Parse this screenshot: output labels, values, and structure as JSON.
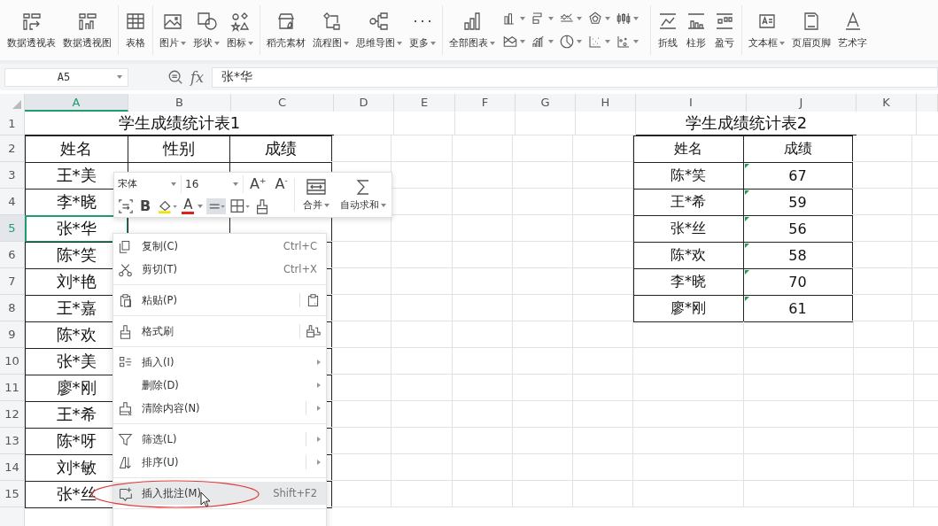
{
  "toolbar": [
    {
      "kind": "pivot",
      "label": "数据透视表",
      "dropdown": false
    },
    {
      "kind": "pivotchart",
      "label": "数据透视图",
      "dropdown": false
    },
    {
      "kind": "separator"
    },
    {
      "kind": "table",
      "label": "表格",
      "dropdown": false
    },
    {
      "kind": "separator"
    },
    {
      "kind": "image",
      "label": "图片",
      "dropdown": true
    },
    {
      "kind": "shape",
      "label": "形状",
      "dropdown": true
    },
    {
      "kind": "icons",
      "label": "图标",
      "dropdown": true
    },
    {
      "kind": "separator"
    },
    {
      "kind": "store",
      "label": "稻壳素材",
      "dropdown": false
    },
    {
      "kind": "flow",
      "label": "流程图",
      "dropdown": true
    },
    {
      "kind": "mindmap",
      "label": "思维导图",
      "dropdown": true
    },
    {
      "kind": "more",
      "label": "更多",
      "dropdown": true
    },
    {
      "kind": "separator"
    },
    {
      "kind": "chart",
      "label": "全部图表",
      "dropdown": true
    },
    {
      "kind": "chartgrid"
    },
    {
      "kind": "separator"
    },
    {
      "kind": "line",
      "label": "折线",
      "dropdown": false
    },
    {
      "kind": "column",
      "label": "柱形",
      "dropdown": false
    },
    {
      "kind": "winloss",
      "label": "盈亏",
      "dropdown": false
    },
    {
      "kind": "separator"
    },
    {
      "kind": "textbox",
      "label": "文本框",
      "dropdown": true
    },
    {
      "kind": "header",
      "label": "页眉页脚",
      "dropdown": false
    },
    {
      "kind": "wordart",
      "label": "艺术字",
      "dropdown": false
    }
  ],
  "formula_bar": {
    "name_box": "A5",
    "fx_label": "fx",
    "value": "张*华"
  },
  "sheet": {
    "columns": [
      {
        "label": "A",
        "selected": true
      },
      {
        "label": "B",
        "selected": false
      },
      {
        "label": "C",
        "selected": false
      },
      {
        "label": "D",
        "selected": false
      },
      {
        "label": "E",
        "selected": false
      },
      {
        "label": "F",
        "selected": false
      },
      {
        "label": "G",
        "selected": false
      },
      {
        "label": "H",
        "selected": false
      },
      {
        "label": "I",
        "selected": false
      },
      {
        "label": "J",
        "selected": false
      },
      {
        "label": "K",
        "selected": false
      }
    ],
    "rows": [
      {
        "label": "1",
        "selected": false
      },
      {
        "label": "2",
        "selected": false
      },
      {
        "label": "3",
        "selected": false
      },
      {
        "label": "4",
        "selected": false
      },
      {
        "label": "5",
        "selected": true
      },
      {
        "label": "6",
        "selected": false
      },
      {
        "label": "7",
        "selected": false
      },
      {
        "label": "8",
        "selected": false
      },
      {
        "label": "9",
        "selected": false
      },
      {
        "label": "10",
        "selected": false
      },
      {
        "label": "11",
        "selected": false
      },
      {
        "label": "12",
        "selected": false
      },
      {
        "label": "13",
        "selected": false
      },
      {
        "label": "14",
        "selected": false
      },
      {
        "label": "15",
        "selected": false
      }
    ]
  },
  "table1": {
    "title": "学生成绩统计表1",
    "columns": [
      "姓名",
      "性别",
      "成绩"
    ],
    "rows": [
      [
        "王*美"
      ],
      [
        "李*晓"
      ],
      [
        "张*华"
      ],
      [
        "陈*笑"
      ],
      [
        "刘*艳"
      ],
      [
        "王*嘉"
      ],
      [
        "陈*欢"
      ],
      [
        "张*美"
      ],
      [
        "廖*刚"
      ],
      [
        "王*希"
      ],
      [
        "陈*呀"
      ],
      [
        "刘*敏"
      ],
      [
        "张*丝"
      ]
    ]
  },
  "table2": {
    "title": "学生成绩统计表2",
    "columns": [
      "姓名",
      "成绩"
    ],
    "rows": [
      {
        "name": "陈*笑",
        "score": "67",
        "flagged": true
      },
      {
        "name": "王*希",
        "score": "59",
        "flagged": true
      },
      {
        "name": "张*丝",
        "score": "56",
        "flagged": true
      },
      {
        "name": "陈*欢",
        "score": "58",
        "flagged": true
      },
      {
        "name": "李*晓",
        "score": "70",
        "flagged": true
      },
      {
        "name": "廖*刚",
        "score": "61",
        "flagged": true
      }
    ]
  },
  "mini_toolbar": {
    "font": "宋体",
    "size": "16",
    "grow": "A",
    "grow_mark": "+",
    "shrink": "A",
    "shrink_mark": "-",
    "bold": "B",
    "font_color": "A",
    "merge": "合并",
    "autosum": "自动求和"
  },
  "context_menu": [
    {
      "kind": "copy",
      "label": "复制(C)",
      "shortcut": "Ctrl+C",
      "submenu": false,
      "split": false,
      "selected": false
    },
    {
      "kind": "cut",
      "label": "剪切(T)",
      "shortcut": "Ctrl+X",
      "submenu": false,
      "split": false,
      "selected": false
    },
    {
      "kind": "separator"
    },
    {
      "kind": "paste",
      "label": "粘贴(P)",
      "submenu": false,
      "split": true,
      "selected": false
    },
    {
      "kind": "separator"
    },
    {
      "kind": "brush",
      "label": "格式刷",
      "submenu": false,
      "split": true,
      "selected": false
    },
    {
      "kind": "separator"
    },
    {
      "kind": "insert",
      "label": "插入(I)",
      "submenu": true,
      "split": false,
      "selected": false
    },
    {
      "kind": "plain",
      "label": "删除(D)",
      "submenu": true,
      "split": false,
      "selected": false
    },
    {
      "kind": "clear",
      "label": "清除内容(N)",
      "submenu": true,
      "split": true,
      "selected": false
    },
    {
      "kind": "separator"
    },
    {
      "kind": "filter",
      "label": "筛选(L)",
      "submenu": true,
      "split": true,
      "selected": false
    },
    {
      "kind": "sort",
      "label": "排序(U)",
      "submenu": true,
      "split": true,
      "selected": false
    },
    {
      "kind": "separator"
    },
    {
      "kind": "comment",
      "label": "插入批注(M)",
      "shortcut": "Shift+F2",
      "submenu": false,
      "split": false,
      "selected": true
    },
    {
      "kind": "separator"
    }
  ]
}
